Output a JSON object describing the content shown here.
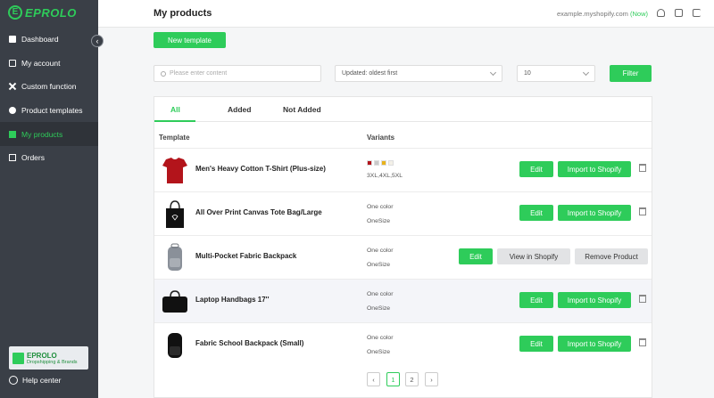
{
  "brand": {
    "name": "EPROLO",
    "logo_letter": "E"
  },
  "sidebar": {
    "items": [
      {
        "label": "Dashboard",
        "icon": "dashboard-icon"
      },
      {
        "label": "My account",
        "icon": "account-icon"
      },
      {
        "label": "Custom function",
        "icon": "custom-function-icon"
      },
      {
        "label": "Product templates",
        "icon": "template-icon"
      },
      {
        "label": "My products",
        "icon": "products-icon",
        "active": true
      },
      {
        "label": "Orders",
        "icon": "orders-icon"
      }
    ],
    "badge": {
      "title": "EPROLO",
      "subtitle": "Dropshipping & Brands"
    },
    "help": "Help center"
  },
  "header": {
    "title": "My products",
    "store": "example.myshopify.com",
    "status": "(Now)"
  },
  "toolbar": {
    "new_template": "New template"
  },
  "filters": {
    "search_placeholder": "Please enter content",
    "sort_value": "Updated: oldest first",
    "page_size": "10",
    "filter_button": "Filter"
  },
  "tabs": [
    "All",
    "Added",
    "Not Added"
  ],
  "table": {
    "headers": {
      "template": "Template",
      "variants": "Variants"
    },
    "rows": [
      {
        "name": "Men's Heavy Cotton T-Shirt (Plus-size)",
        "variant_line1": "",
        "variant_line2": "3XL,4XL,5XL",
        "swatches": [
          "#b3141b",
          "#c9c9c9",
          "#e8b21b",
          "#f3f0e8"
        ],
        "actions": [
          "Edit",
          "Import to Shopify"
        ],
        "trash": true,
        "image": "tshirt"
      },
      {
        "name": "All Over Print Canvas Tote Bag/Large",
        "variant_line1": "One color",
        "variant_line2": "OneSize",
        "actions": [
          "Edit",
          "Import to Shopify"
        ],
        "trash": true,
        "image": "tote"
      },
      {
        "name": "Multi-Pocket Fabric Backpack",
        "variant_line1": "One color",
        "variant_line2": "OneSize",
        "actions": [
          "Edit",
          "View in Shopify",
          "Remove Product"
        ],
        "trash": false,
        "image": "backpack-gray"
      },
      {
        "name": "Laptop Handbags 17''",
        "variant_line1": "One color",
        "variant_line2": "OneSize",
        "actions": [
          "Edit",
          "Import to Shopify"
        ],
        "trash": true,
        "image": "handbag"
      },
      {
        "name": "Fabric School Backpack (Small)",
        "variant_line1": "One color",
        "variant_line2": "OneSize",
        "actions": [
          "Edit",
          "Import to Shopify"
        ],
        "trash": true,
        "image": "backpack-black"
      }
    ]
  },
  "pagination": {
    "prev": "‹",
    "pages": [
      "1",
      "2"
    ],
    "current": "1",
    "next": "›"
  },
  "colors": {
    "accent": "#2ecc5a",
    "sidebar_bg": "#3a3f47"
  }
}
